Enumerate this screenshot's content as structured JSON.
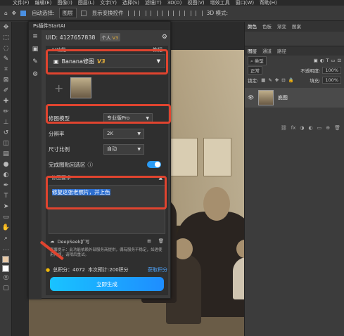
{
  "menubar": {
    "items": [
      "文件(F)",
      "编辑(E)",
      "图像(I)",
      "图层(L)",
      "文字(Y)",
      "选择(S)",
      "滤镜(T)",
      "3D(D)",
      "视图(V)",
      "增效工具",
      "窗口(W)",
      "帮助(H)"
    ]
  },
  "options": {
    "auto_select_label": "自动选择:",
    "layer_dropdown": "图层",
    "show_transform_label": "显示变换控件",
    "mode3d_label": "3D 模式:"
  },
  "plugin": {
    "title": "Ps插件StartAI",
    "uid": "UID: 4127657838",
    "account_badge": "个人",
    "account_version": "V3",
    "ai_section_label": "AI功能",
    "ai_section_link": "教程",
    "function_select": "Banana修图",
    "function_version": "V3",
    "params": [
      {
        "label": "修图模型",
        "value": "专业版Pro"
      },
      {
        "label": "分辨率",
        "value": "2K"
      },
      {
        "label": "尺寸比例",
        "value": "自动"
      }
    ],
    "paste_label": "完成图贴回选区",
    "requirement_label": "修图要求",
    "prompt_text": "修复这张老照片，并上色",
    "deepseek_label": "DeepSeek扩写",
    "hint_text": "温馨提示：此功能依赖外部服务商提供，偶有服务不稳定，如遇使用问题，请稍后重试。",
    "points_label": "总积分：4072",
    "points_cost": "本次预计:200积分",
    "points_link": "获取积分",
    "generate_button": "立即生成"
  },
  "right_panel": {
    "top_tabs": [
      "颜色",
      "色板",
      "渐变",
      "图案"
    ],
    "layer_tabs": [
      "图层",
      "通道",
      "路径"
    ],
    "filter_label": "类型",
    "blend_mode": "正常",
    "opacity_label": "不透明度:",
    "opacity_value": "100%",
    "lock_label": "锁定:",
    "fill_label": "填充:",
    "fill_value": "100%",
    "layer_name": "底图"
  },
  "colors": {
    "accent": "#2a9cf5",
    "highlight": "#e0442f",
    "gold": "#e9b23a"
  }
}
